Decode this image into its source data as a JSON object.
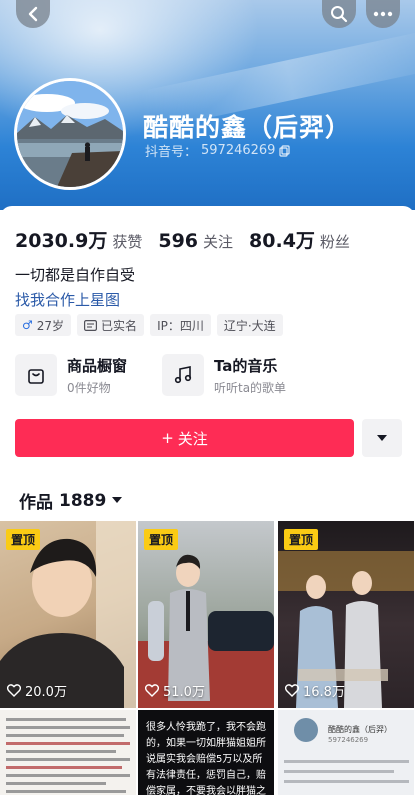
{
  "header": {
    "profile_name": "酷酷的鑫（后羿）",
    "douyin_id_label": "抖音号：",
    "douyin_id": "597246269"
  },
  "stats": [
    {
      "num": "2030.9万",
      "label": "获赞"
    },
    {
      "num": "596",
      "label": "关注"
    },
    {
      "num": "80.4万",
      "label": "粉丝"
    }
  ],
  "bio": "一切都是自作自受",
  "link_text": "找我合作上星图",
  "tags": {
    "age": "27岁",
    "verified": "已实名",
    "ip": "IP：四川",
    "location": "辽宁·大连"
  },
  "features": {
    "shop_title": "商品橱窗",
    "shop_sub": "0件好物",
    "music_title": "Ta的音乐",
    "music_sub": "听听ta的歌单"
  },
  "follow_label": "关注",
  "works": {
    "label": "作品",
    "count": "1889"
  },
  "videos": [
    {
      "pinned": "置顶",
      "likes": "20.0万"
    },
    {
      "pinned": "置顶",
      "likes": "51.0万"
    },
    {
      "pinned": "置顶",
      "likes": "16.8万"
    }
  ],
  "row2": {
    "middle_text": "很多人怜我跪了，我不会跑的，如果一切如胖猫姐姐所说属实我会赔偿5万以及所有法律责任，惩罚自己，赔偿家属，不要我会以胖猫之诉愿",
    "right_name": "酷酷的鑫（后羿）",
    "right_id": "597246269"
  },
  "colors": {
    "accent": "#fe2c55",
    "pin_badge": "#facb14",
    "link": "#2b5aa8"
  }
}
